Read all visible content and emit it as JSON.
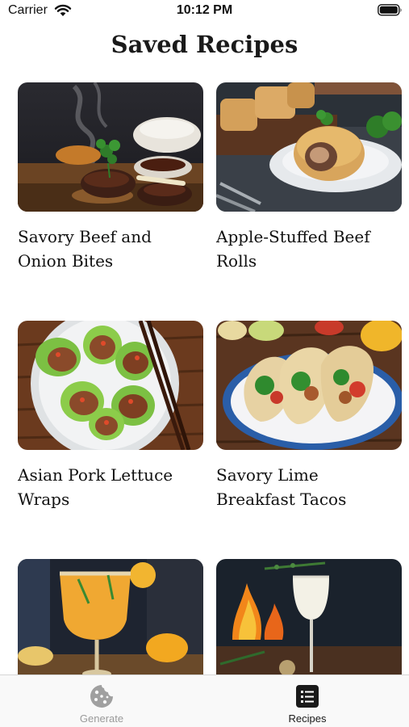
{
  "status_bar": {
    "carrier": "Carrier",
    "time": "10:12 PM",
    "wifi_icon": "wifi-icon",
    "battery_icon": "battery-icon"
  },
  "page": {
    "title": "Saved Recipes"
  },
  "recipes": [
    {
      "name": "Savory Beef and Onion Bites"
    },
    {
      "name": "Apple-Stuffed Beef Rolls"
    },
    {
      "name": "Asian Pork Lettuce Wraps"
    },
    {
      "name": "Savory Lime Breakfast Tacos"
    },
    {
      "name": ""
    },
    {
      "name": ""
    }
  ],
  "tab_bar": {
    "tabs": [
      {
        "label": "Generate",
        "icon": "cookie-icon",
        "selected": false
      },
      {
        "label": "Recipes",
        "icon": "list-icon",
        "selected": true
      }
    ],
    "colors": {
      "selected": "#1a1a1a",
      "unselected": "#9a9a9a"
    }
  }
}
